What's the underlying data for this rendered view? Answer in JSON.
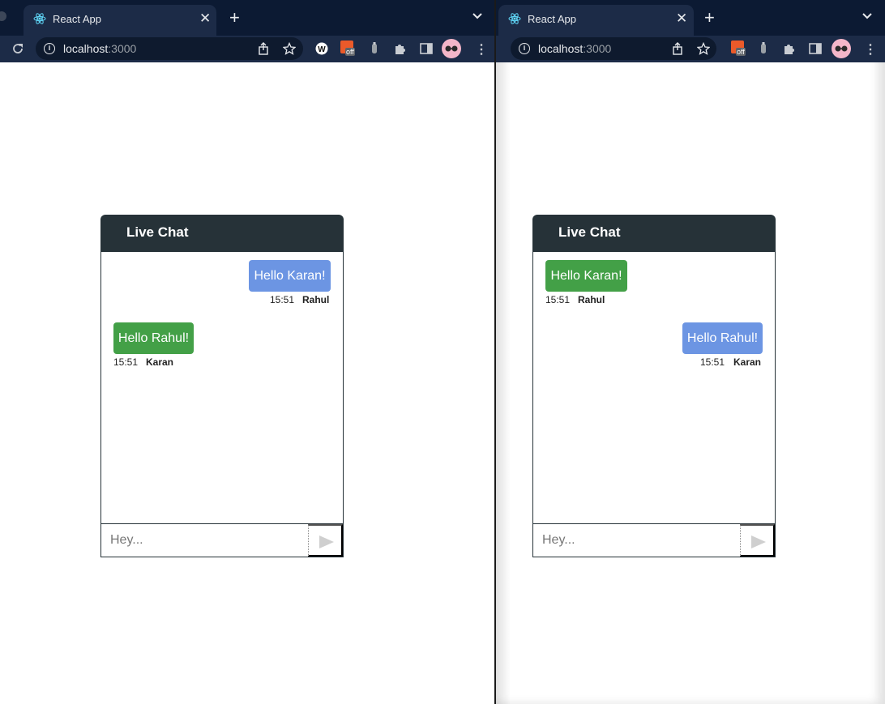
{
  "windows": [
    {
      "tab_title": "React App",
      "url_host": "localhost",
      "url_port": ":3000",
      "chat": {
        "header": "Live Chat",
        "messages": [
          {
            "text": "Hello Karan!",
            "time": "15:51",
            "author": "Rahul",
            "side": "right",
            "color": "#6c95e3"
          },
          {
            "text": "Hello Rahul!",
            "time": "15:51",
            "author": "Karan",
            "side": "left",
            "color": "#43a047"
          }
        ],
        "input_placeholder": "Hey..."
      }
    },
    {
      "tab_title": "React App",
      "url_host": "localhost",
      "url_port": ":3000",
      "chat": {
        "header": "Live Chat",
        "messages": [
          {
            "text": "Hello Karan!",
            "time": "15:51",
            "author": "Rahul",
            "side": "left",
            "color": "#43a047"
          },
          {
            "text": "Hello Rahul!",
            "time": "15:51",
            "author": "Karan",
            "side": "right",
            "color": "#6c95e3"
          }
        ],
        "input_placeholder": "Hey..."
      }
    }
  ],
  "extension_badge": "off",
  "colors": {
    "tabbar": "#0c1a33",
    "toolbar": "#1c2b47",
    "chat_header": "#263238",
    "own_bubble": "#6c95e3",
    "other_bubble": "#43a047"
  }
}
